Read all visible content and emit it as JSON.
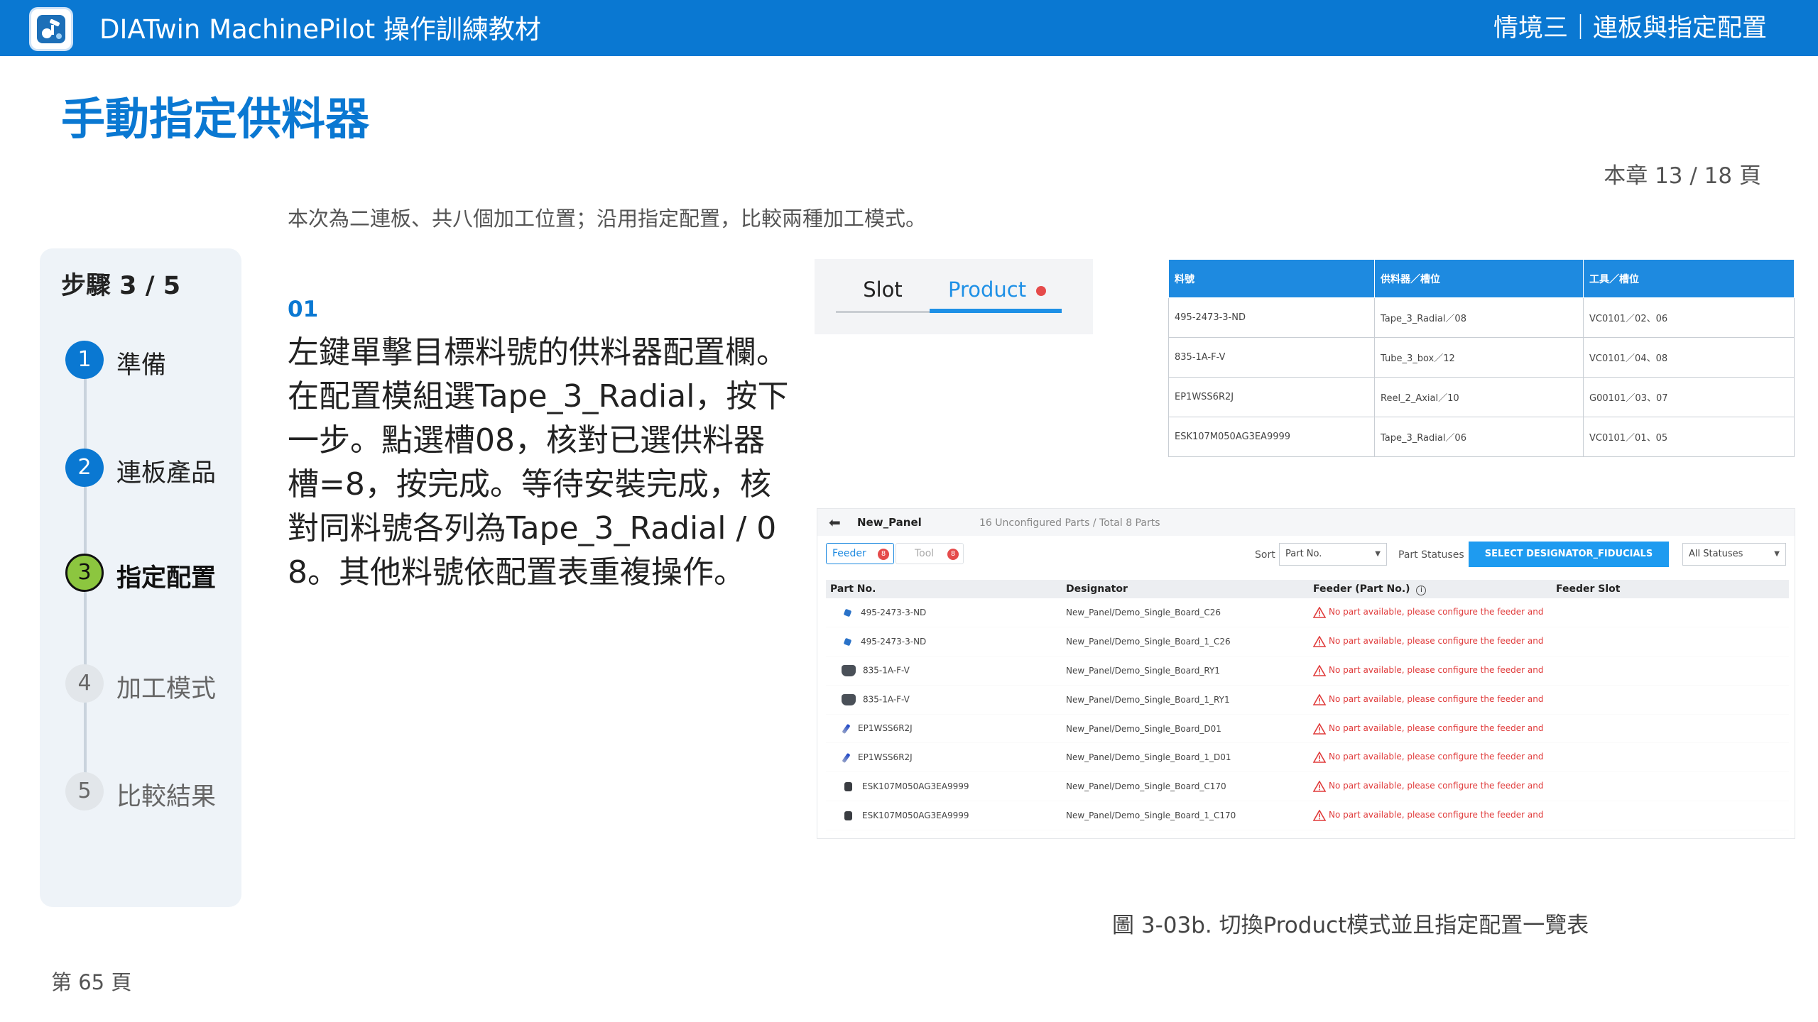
{
  "topbar": {
    "app_title": "DIATwin MachinePilot 操作訓練教材",
    "chapter_title": "情境三｜連板與指定配置"
  },
  "page": {
    "heading": "手動指定供料器",
    "chapter_page": "本章 13 / 18 頁",
    "subtitle": "本次為二連板、共八個加工位置；沿用指定配置，比較兩種加工模式。",
    "footer_page": "第 65 頁",
    "caption": "圖 3-03b. 切換Product模式並且指定配置一覽表"
  },
  "stepper": {
    "header": "步驟 3 / 5",
    "steps": [
      {
        "num": "1",
        "label": "準備",
        "state": "done"
      },
      {
        "num": "2",
        "label": "連板產品",
        "state": "done"
      },
      {
        "num": "3",
        "label": "指定配置",
        "state": "current"
      },
      {
        "num": "4",
        "label": "加工模式",
        "state": "todo"
      },
      {
        "num": "5",
        "label": "比較結果",
        "state": "todo"
      }
    ]
  },
  "instruction": {
    "number": "01",
    "text": "左鍵單擊目標料號的供料器配置欄。在配置模組選Tape_3_Radial，按下一步。點選槽08，核對已選供料器槽=8，按完成。等待安裝完成，核對同料號各列為Tape_3_Radial / 08。其他料號依配置表重複操作。"
  },
  "mode_tabs": {
    "slot": "Slot",
    "product": "Product"
  },
  "config_table": {
    "headers": [
      "料號",
      "供料器／槽位",
      "工具／槽位"
    ],
    "rows": [
      [
        "495-2473-3-ND",
        "Tape_3_Radial／08",
        "VC0101／02、06"
      ],
      [
        "835-1A-F-V",
        "Tube_3_box／12",
        "VC0101／04、08"
      ],
      [
        "EP1WSS6R2J",
        "Reel_2_Axial／10",
        "G00101／03、07"
      ],
      [
        "ESK107M050AG3EA9999",
        "Tape_3_Radial／06",
        "VC0101／01、05"
      ]
    ]
  },
  "panel": {
    "name": "New_Panel",
    "count_text": "16 Unconfigured Parts / Total 8 Parts",
    "feeder_tab": "Feeder",
    "feeder_badge": "8",
    "tool_tab": "Tool",
    "tool_badge": "8",
    "sort_label": "Sort",
    "sort_value": "Part No.",
    "status_label": "Part Statuses",
    "select_button": "SELECT DESIGNATOR_FIDUCIALS",
    "status_value": "All Statuses",
    "headers": [
      "Part No.",
      "Designator",
      "Feeder (Part No.)",
      "Feeder Slot"
    ],
    "warning": "No part available, please configure the feeder and",
    "rows": [
      {
        "part": "495-2473-3-ND",
        "designator": "New_Panel/Demo_Single_Board_C26",
        "icon": "blue-capacitor-icon"
      },
      {
        "part": "495-2473-3-ND",
        "designator": "New_Panel/Demo_Single_Board_1_C26",
        "icon": "blue-capacitor-icon"
      },
      {
        "part": "835-1A-F-V",
        "designator": "New_Panel/Demo_Single_Board_RY1",
        "icon": "relay-icon"
      },
      {
        "part": "835-1A-F-V",
        "designator": "New_Panel/Demo_Single_Board_1_RY1",
        "icon": "relay-icon"
      },
      {
        "part": "EP1WSS6R2J",
        "designator": "New_Panel/Demo_Single_Board_D01",
        "icon": "diode-icon"
      },
      {
        "part": "EP1WSS6R2J",
        "designator": "New_Panel/Demo_Single_Board_1_D01",
        "icon": "diode-icon"
      },
      {
        "part": "ESK107M050AG3EA9999",
        "designator": "New_Panel/Demo_Single_Board_C170",
        "icon": "electrolytic-capacitor-icon"
      },
      {
        "part": "ESK107M050AG3EA9999",
        "designator": "New_Panel/Demo_Single_Board_1_C170",
        "icon": "electrolytic-capacitor-icon"
      }
    ]
  },
  "colors": {
    "brand": "#0a78d2",
    "accent_green": "#8cc63f",
    "error": "#e03b3b"
  }
}
